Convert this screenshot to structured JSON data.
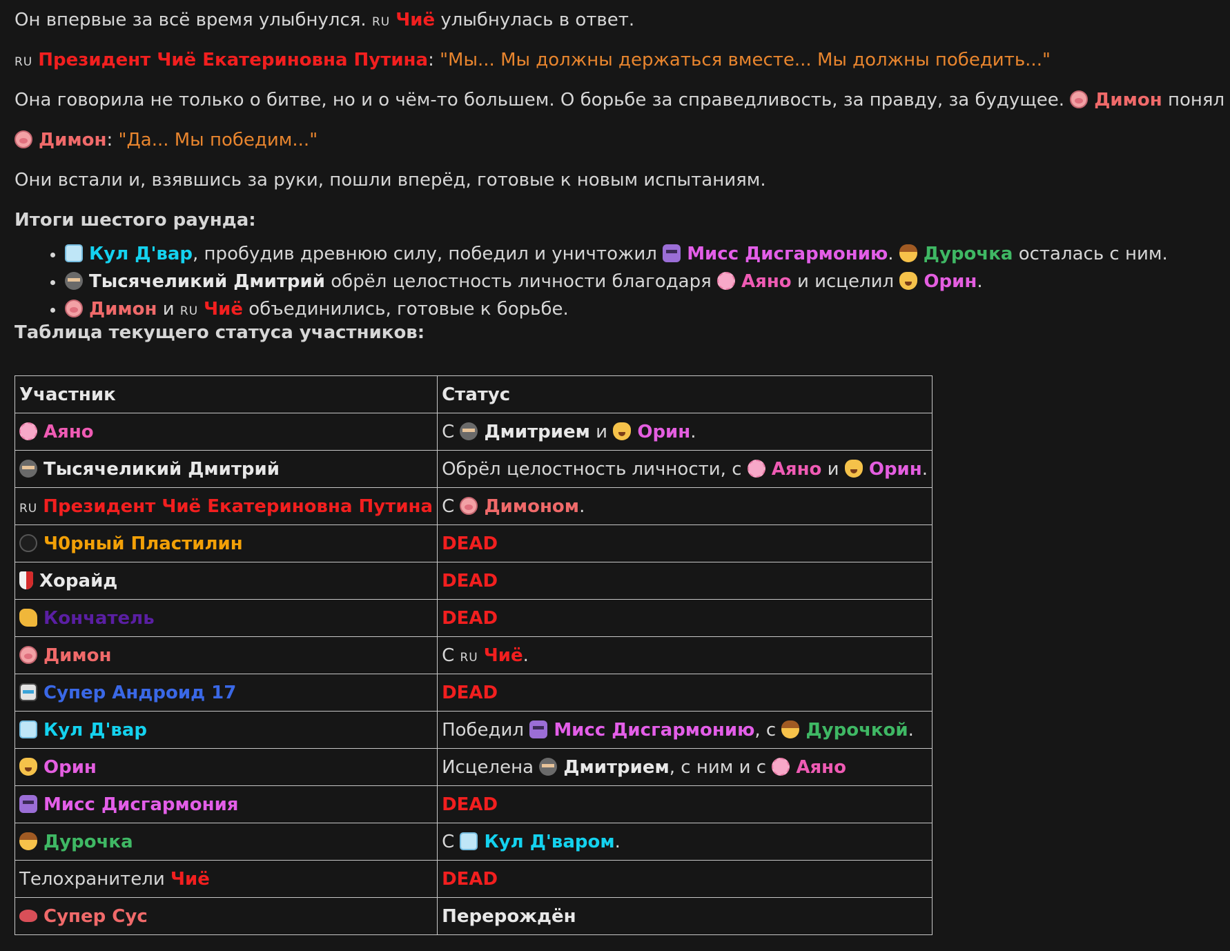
{
  "story": {
    "p1": {
      "text1": "Он впервые за всё время улыбнулся.",
      "ru": "RU",
      "name": "Чиё",
      "text2": "улыбнулась в ответ."
    },
    "p2": {
      "ru": "RU",
      "name": "Президент Чиё Екатериновна Путина",
      "colon": ":",
      "quote": "\"Мы... Мы должны держаться вместе... Мы должны победить...\""
    },
    "p3": {
      "text1": "Она говорила не только о битве, но и о чём-то большем. О борьбе за справедливость, за правду, за будущее.",
      "icon": "pig-face-icon",
      "name": "Димон",
      "text2": "понял её."
    },
    "p4": {
      "icon": "pig-face-icon",
      "name": "Димон",
      "colon": ":",
      "quote": "\"Да... Мы победим...\""
    },
    "p5": {
      "text": "Они встали и, взявшись за руки, пошли вперёд, готовые к новым испытаниям."
    }
  },
  "summary": {
    "heading": "Итоги шестого раунда:",
    "items": [
      {
        "name1": "Кул Д'вар",
        "text1": ", пробудив древнюю силу, победил и уничтожил",
        "name2": "Мисс Дисгармонию",
        "text2": ".",
        "name3": "Дурочка",
        "text3": "осталась с ним."
      },
      {
        "name1": "Тысячеликий Дмитрий",
        "text1": "обрёл целостность личности благодаря",
        "name2": "Аяно",
        "text2": "и исцелил",
        "name3": "Орин",
        "text3": "."
      },
      {
        "name1": "Димон",
        "text1": "и",
        "ru": "RU",
        "name2": "Чиё",
        "text2": "объединились, готовые к борьбе."
      }
    ]
  },
  "table": {
    "heading": "Таблица текущего статуса участников:",
    "columns": [
      "Участник",
      "Статус"
    ],
    "dead": "DEAD",
    "rows": {
      "ayano": {
        "name": "Аяно",
        "s1": "С",
        "s2": "Дмитрием",
        "s3": "и",
        "s4": "Орин",
        "s5": "."
      },
      "dmitry": {
        "name": "Тысячеликий Дмитрий",
        "s1": "Обрёл целостность личности, с",
        "s2": "Аяно",
        "s3": "и",
        "s4": "Орин",
        "s5": "."
      },
      "chie": {
        "ru": "RU",
        "name": "Президент Чиё Екатериновна Путина",
        "s1": "С",
        "s2": "Димоном",
        "s3": "."
      },
      "plast": {
        "name": "Ч0рный Пластилин"
      },
      "horaid": {
        "name": "Хорайд"
      },
      "konch": {
        "name": "Кончатель"
      },
      "dimon": {
        "name": "Димон",
        "s1": "С",
        "ru": "RU",
        "s2": "Чиё",
        "s3": "."
      },
      "android": {
        "name": "Супер Андроид 17"
      },
      "kul": {
        "name": "Кул Д'вар",
        "s1": "Победил",
        "s2": "Мисс Дисгармонию",
        "s3": ", с",
        "s4": "Дурочкой",
        "s5": "."
      },
      "orin": {
        "name": "Орин",
        "s1": "Исцелена",
        "s2": "Дмитрием",
        "s3": ", с ним и с",
        "s4": "Аяно"
      },
      "miss": {
        "name": "Мисс Дисгармония"
      },
      "duro": {
        "name": "Дурочка",
        "s1": "С",
        "s2": "Кул Д'варом",
        "s3": "."
      },
      "guards": {
        "text": "Телохранители",
        "name": "Чиё"
      },
      "sus": {
        "name": "Супер Сус",
        "status": "Перерождён"
      }
    }
  },
  "colors": {
    "background": "#161616",
    "text": "#d6d6d6",
    "quote": "#e8852e",
    "dead": "#f21f1f",
    "ayano": "#ef5bb4",
    "chie": "#f21f1f",
    "dimon": "#f06a6a",
    "kul": "#14d2ef",
    "orin": "#e45ee0",
    "miss": "#e35ee8",
    "duro": "#3fb864",
    "plast": "#f2a007",
    "konch": "#5a1fa3",
    "android": "#3a68e6"
  },
  "icons": {
    "ayano": "cherry-blossom-icon",
    "dmitry": "ninja-icon",
    "plast": "black-circle-icon",
    "horaid": "shield-icon",
    "konch": "flexed-biceps-icon",
    "dimon": "pig-face-icon",
    "android": "robot-icon",
    "kul": "ice-cube-icon",
    "orin": "cat-face-icon",
    "miss": "alien-monster-icon",
    "duro": "girl-icon",
    "sus": "lips-icon"
  }
}
